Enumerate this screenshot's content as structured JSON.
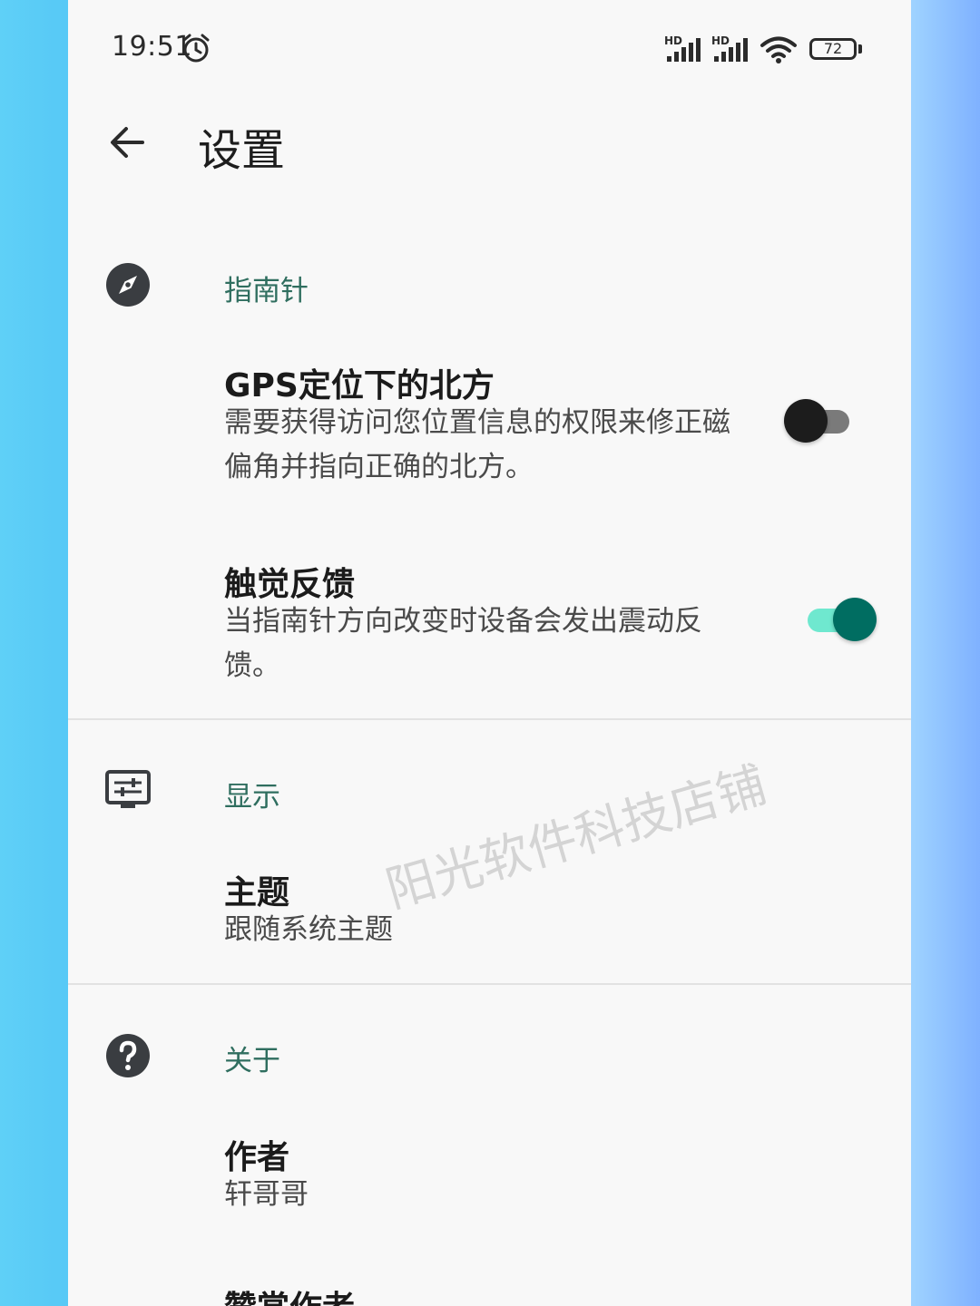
{
  "status_bar": {
    "time": "19:51",
    "alarm_icon": "alarm-clock-icon",
    "network_badge_1": "HD",
    "network_badge_2": "HD",
    "battery_level": "72"
  },
  "app_bar": {
    "back_icon": "arrow-left-icon",
    "title": "设置"
  },
  "sections": {
    "compass": {
      "icon": "compass-icon",
      "title": "指南针",
      "items": [
        {
          "title": "GPS定位下的北方",
          "summary": "需要获得访问您位置信息的权限来修正磁偏角并指向正确的北方。",
          "switch_on": false
        },
        {
          "title": "触觉反馈",
          "summary": "当指南针方向改变时设备会发出震动反馈。",
          "switch_on": true
        }
      ]
    },
    "display": {
      "icon": "display-settings-icon",
      "title": "显示",
      "items": [
        {
          "title": "主题",
          "summary": "跟随系统主题"
        }
      ]
    },
    "about": {
      "icon": "help-circle-icon",
      "title": "关于",
      "items": [
        {
          "title": "作者",
          "summary": "轩哥哥"
        },
        {
          "title": "赞赏作者",
          "summary": ""
        }
      ]
    }
  },
  "watermark": "阳光软件科技店铺",
  "colors": {
    "section_title": "#2f6e5f",
    "switch_on_thumb": "#006d61",
    "switch_on_track": "#6fe8cf",
    "switch_off_thumb": "#1c1c1c",
    "switch_off_track": "#7a7a7a"
  }
}
